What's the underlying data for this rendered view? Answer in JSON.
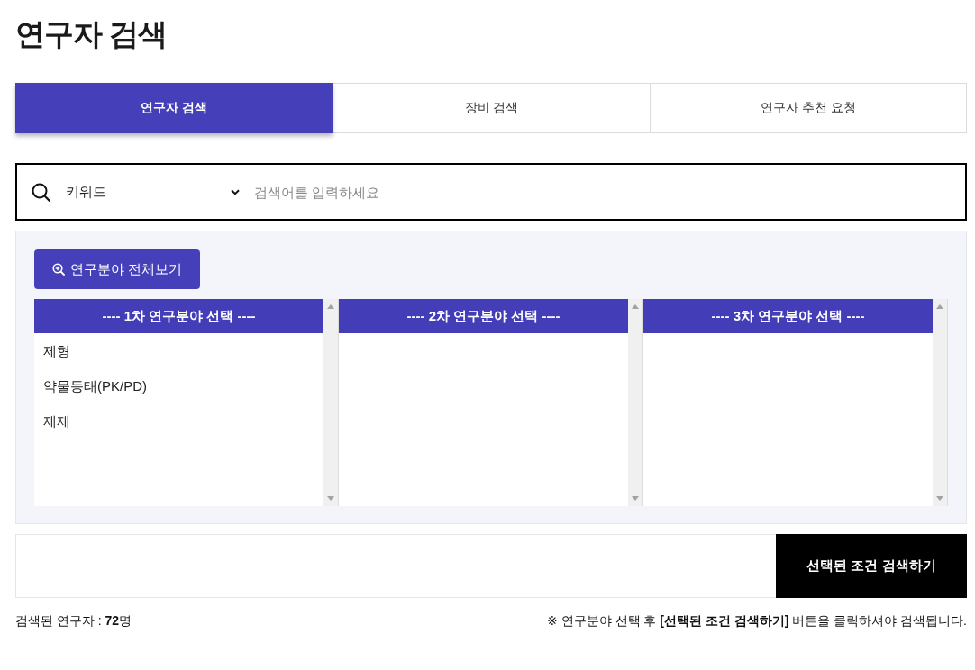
{
  "page_title": "연구자 검색",
  "tabs": [
    {
      "label": "연구자 검색",
      "selected": true
    },
    {
      "label": "장비 검색",
      "selected": false
    },
    {
      "label": "연구자 추천 요청",
      "selected": false
    }
  ],
  "search": {
    "field_type": "키워드",
    "placeholder": "검색어를 입력하세요"
  },
  "browse_all_button": "연구분야 전체보기",
  "field_lists": [
    {
      "header": "---- 1차 연구분야 선택 ----",
      "items": [
        {
          "label": "제형",
          "selected": false
        },
        {
          "label": "약물동태(PK/PD)",
          "selected": false
        },
        {
          "label": "제제",
          "selected": false
        }
      ]
    },
    {
      "header": "---- 2차 연구분야 선택 ----"
    },
    {
      "header": "---- 3차 연구분야 선택 ----"
    }
  ],
  "submit_button": "선택된 조건 검색하기",
  "result_count": "검색된 연구자 : **72**명",
  "notice": "※ 연구분야 선택 후 **[선택된 조건 검색하기]** 버튼을 클릭하셔야 검색됩니다."
}
